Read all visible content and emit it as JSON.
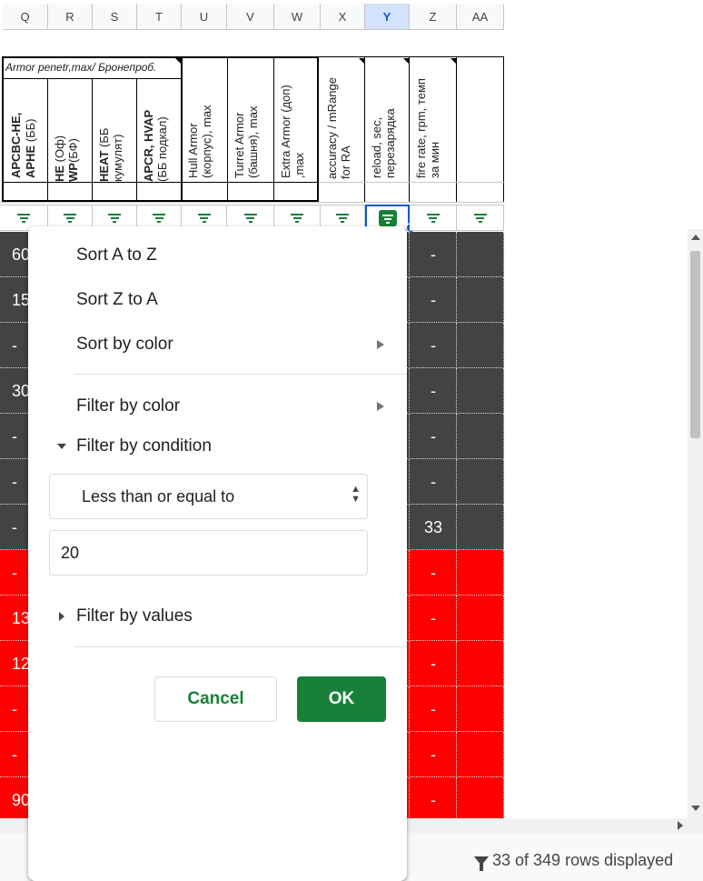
{
  "columns": [
    "Q",
    "R",
    "S",
    "T",
    "U",
    "V",
    "W",
    "X",
    "Y",
    "Z",
    "AA"
  ],
  "header": {
    "armor_group": "Armor penetr,max/ Бронепроб.",
    "q_bold": "APCBC-HE, APHE",
    "q_rest": " (ББ)",
    "r_line1_bold": "HE",
    "r_line1_rest": " (Оф)",
    "r_line2_bold": "WP",
    "r_line2_rest": "(БФ)",
    "s_line1_bold": "HEAT",
    "s_line1_rest": " (ББ",
    "s_line2": "кумулят)",
    "t_line1": "APCR, HVAP",
    "t_line2": "(ББ подкал)",
    "u_line1": "Hull Armor",
    "u_line2": "(корпус), max",
    "v_line1": "Turret Armor",
    "v_line2": "(башня), max",
    "w_line1": "Extra Armor (доп)",
    "w_line2": ",max",
    "x_line1": "accuracy / mRange",
    "x_line2": "for RA",
    "y_line1": "reload, sec,",
    "y_line2": "перезарядка",
    "z_line1": "fire rate, rpm, темп",
    "z_line2": "за мин"
  },
  "rows": [
    {
      "left": "60",
      "z": "-",
      "color": "#434343"
    },
    {
      "left": "15",
      "z": "-",
      "color": "#434343"
    },
    {
      "left": "-",
      "z": "-",
      "color": "#434343"
    },
    {
      "left": "30",
      "z": "-",
      "color": "#434343"
    },
    {
      "left": "-",
      "z": "-",
      "color": "#434343"
    },
    {
      "left": "-",
      "z": "-",
      "color": "#434343"
    },
    {
      "left": "-",
      "z": "33",
      "color": "#434343"
    },
    {
      "left": "-",
      "z": "-",
      "color": "#ff0000"
    },
    {
      "left": "13",
      "z": "-",
      "color": "#ff0000"
    },
    {
      "left": "12",
      "z": "-",
      "color": "#ff0000"
    },
    {
      "left": "-",
      "z": "-",
      "color": "#ff0000"
    },
    {
      "left": "-",
      "z": "-",
      "color": "#ff0000"
    },
    {
      "left": "90",
      "z": "-",
      "color": "#ff0000"
    }
  ],
  "menu": {
    "sort_az": "Sort A to Z",
    "sort_za": "Sort Z to A",
    "sort_color": "Sort by color",
    "filter_color": "Filter by color",
    "filter_condition": "Filter by condition",
    "condition_value": "Less than or equal to",
    "condition_input": "20",
    "filter_values": "Filter by values",
    "cancel": "Cancel",
    "ok": "OK"
  },
  "status": {
    "rows_displayed": "33 of 349 rows displayed"
  },
  "colors": {
    "accent_green": "#188038",
    "dark_row": "#434343",
    "red_row": "#ff0000"
  }
}
